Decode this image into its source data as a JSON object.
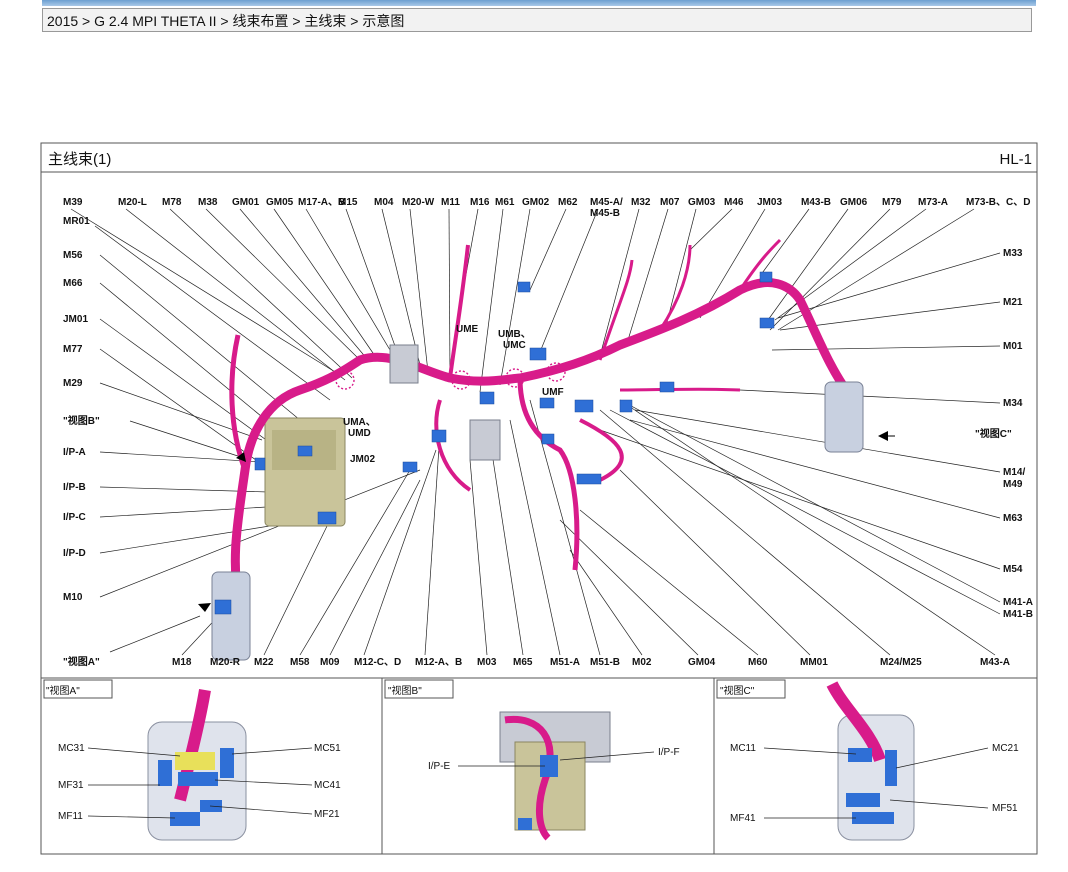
{
  "breadcrumb": "2015 > G 2.4 MPI THETA II > 线束布置 > 主线束 > 示意图",
  "header": {
    "title": "主线束(1)",
    "code": "HL-1"
  },
  "colors": {
    "harness": "#d81b8a",
    "connector": "#2f6fd6",
    "bracket": "#c8d0e0",
    "junction": "#c9c49a",
    "frame": "#555555"
  },
  "main_labels": {
    "top": [
      {
        "t": "M39"
      },
      {
        "t": "M20-L"
      },
      {
        "t": "M78"
      },
      {
        "t": "M38"
      },
      {
        "t": "GM01"
      },
      {
        "t": "GM05"
      },
      {
        "t": "M17-A、B"
      },
      {
        "t": "M15"
      },
      {
        "t": "M04"
      },
      {
        "t": "M20-W"
      },
      {
        "t": "M11"
      },
      {
        "t": "M16"
      },
      {
        "t": "M61"
      },
      {
        "t": "GM02"
      },
      {
        "t": "M62"
      },
      {
        "t": "M45-A/"
      },
      {
        "t": "M32"
      },
      {
        "t": "M07"
      },
      {
        "t": "GM03"
      },
      {
        "t": "M46"
      },
      {
        "t": "JM03"
      },
      {
        "t": "M43-B"
      },
      {
        "t": "GM06"
      },
      {
        "t": "M79"
      },
      {
        "t": "M73-A"
      },
      {
        "t": "M73-B、C、D"
      }
    ],
    "top2": [
      {
        "t": "MR01"
      },
      {
        "t": "M45-B"
      }
    ],
    "left": [
      {
        "t": "M56"
      },
      {
        "t": "M66"
      },
      {
        "t": "JM01"
      },
      {
        "t": "M77"
      },
      {
        "t": "M29"
      },
      {
        "t": "\"视图B\""
      },
      {
        "t": "I/P-A"
      },
      {
        "t": "I/P-B"
      },
      {
        "t": "I/P-C"
      },
      {
        "t": "I/P-D"
      },
      {
        "t": "M10"
      },
      {
        "t": "\"视图A\""
      }
    ],
    "bottom": [
      {
        "t": "M18"
      },
      {
        "t": "M20-R"
      },
      {
        "t": "M22"
      },
      {
        "t": "M58"
      },
      {
        "t": "M09"
      },
      {
        "t": "M12-C、D"
      },
      {
        "t": "M12-A、B"
      },
      {
        "t": "M03"
      },
      {
        "t": "M65"
      },
      {
        "t": "M51-A"
      },
      {
        "t": "M51-B"
      },
      {
        "t": "M02"
      },
      {
        "t": "GM04"
      },
      {
        "t": "M60"
      },
      {
        "t": "MM01"
      },
      {
        "t": "M24/M25"
      },
      {
        "t": "M43-A"
      }
    ],
    "right": [
      {
        "t": "M33"
      },
      {
        "t": "M21"
      },
      {
        "t": "M01"
      },
      {
        "t": "M34"
      },
      {
        "t": "\"视图C\""
      },
      {
        "t": "M14/"
      },
      {
        "t": "M49"
      },
      {
        "t": "M63"
      },
      {
        "t": "M54"
      },
      {
        "t": "M41-A"
      },
      {
        "t": "M41-B"
      }
    ],
    "inner": [
      {
        "t": "UME"
      },
      {
        "t": "UMB、"
      },
      {
        "t": "UMC"
      },
      {
        "t": "UMF"
      },
      {
        "t": "UMA、"
      },
      {
        "t": "UMD"
      },
      {
        "t": "JM02"
      }
    ]
  },
  "views": [
    {
      "title": "\"视图A\"",
      "labels": [
        "MC31",
        "MF31",
        "MF11",
        "MC51",
        "MC41",
        "MF21"
      ]
    },
    {
      "title": "\"视图B\"",
      "labels": [
        "I/P-E",
        "I/P-F"
      ]
    },
    {
      "title": "\"视图C\"",
      "labels": [
        "MC11",
        "MF41",
        "MC21",
        "MF51"
      ]
    }
  ]
}
